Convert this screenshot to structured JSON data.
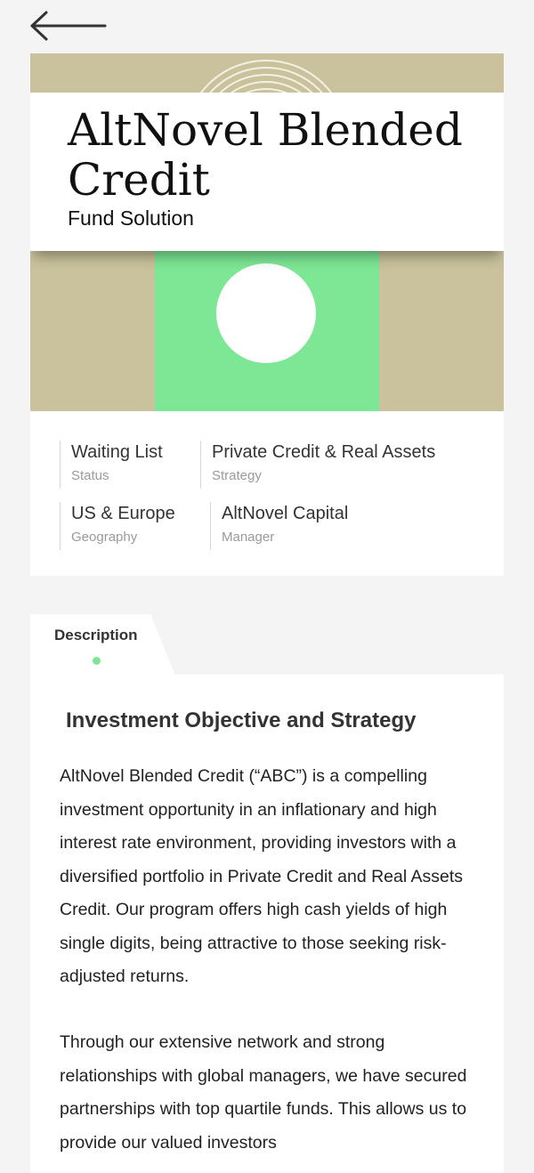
{
  "nav": {
    "back_icon": "arrow-left-icon"
  },
  "hero": {
    "title": "AltNovel Blended Credit",
    "subtitle": "Fund Solution",
    "colors": {
      "background": "#c9c29c",
      "accent_green": "#7de795",
      "circle": "#ffffff"
    }
  },
  "info": {
    "status": {
      "value": "Waiting List",
      "label": "Status"
    },
    "strategy": {
      "value": "Private Credit & Real Assets",
      "label": "Strategy"
    },
    "geography": {
      "value": "US & Europe",
      "label": "Geography"
    },
    "manager": {
      "value": "AltNovel Capital",
      "label": "Manager"
    }
  },
  "tabs": {
    "description": {
      "label": "Description",
      "active": true
    }
  },
  "content": {
    "heading": "Investment Objective and Strategy",
    "paragraphs": [
      "AltNovel Blended Credit (“ABC”) is a compelling investment opportunity in an inflationary and high interest rate environment, providing investors with a diversified portfolio in Private Credit and Real Assets Credit. Our program offers high cash yields of high single digits, being attractive to those seeking risk-adjusted returns.",
      "Through our extensive network and strong relationships with global managers, we have secured partnerships with top quartile funds. This allows us to provide our valued investors"
    ]
  }
}
